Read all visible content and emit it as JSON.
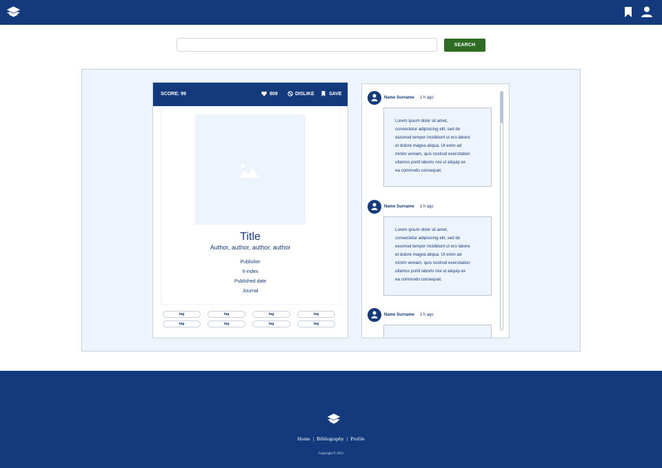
{
  "header": {
    "logo_icon": "graduation-cap-icon",
    "bookmark_icon": "bookmark-icon",
    "user_icon": "user-icon"
  },
  "search": {
    "value": "",
    "placeholder": "",
    "button_label": "SEARCH"
  },
  "card": {
    "score": "SCORE: 99",
    "likes": "809",
    "dislike_label": "DISLIKE",
    "save_label": "SAVE",
    "image_icon": "image-placeholder-icon",
    "title": "Title",
    "authors": "Author, author, author, author",
    "publisher": "Publisher",
    "h_index": "h-index",
    "published_date": "Published date",
    "journal": "Journal",
    "tags": [
      "tag",
      "tag",
      "tag",
      "tag",
      "tag",
      "tag",
      "tag",
      "tag"
    ]
  },
  "comments": [
    {
      "name": "Name Surname",
      "time": "1 h ago",
      "lines": [
        "Lorem ipsum dolor sit amet,",
        "consectetur adipisicing elit, sed do",
        "eiusmod tempor incididunt ut ero labore",
        "et dolore magna aliqua. Ut enim ad",
        "minim veniam, quis nostrud exercitation",
        "ullamco poriti laboris nisi ut aliquip ex",
        "ea commodo consequat."
      ]
    },
    {
      "name": "Name Surname",
      "time": "1 h ago",
      "lines": [
        "Lorem ipsum dolor sit amet,",
        "consectetur adipisicing elit, sed do",
        "eiusmod tempor incididunt ut ero labore",
        "et dolore magna aliqua. Ut enim ad",
        "minim veniam, quis nostrud exercitation",
        "ullamco poriti laboris nisi ut aliquip ex",
        "ea commodo consequat."
      ]
    },
    {
      "name": "Name Surname",
      "time": "1 h ago"
    }
  ],
  "footer": {
    "links": [
      "Home",
      "Bibliography",
      "Profile"
    ],
    "copyright": "Copyright © 2021"
  },
  "colors": {
    "primary": "#123a7c",
    "accent": "#2e6b23",
    "panel": "#edf4fc"
  }
}
